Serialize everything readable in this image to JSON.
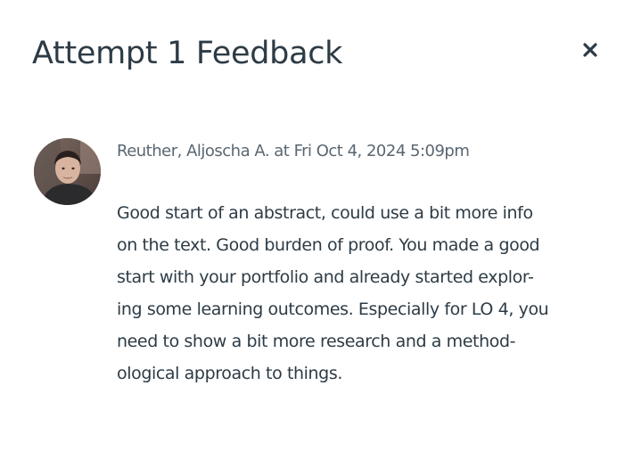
{
  "dialog": {
    "title": "Attempt 1 Feedback",
    "close_icon": "close-icon"
  },
  "comment": {
    "avatar_icon": "user-avatar-photo",
    "meta": "Reuther, Aljoscha A. at Fri Oct 4, 2024 5:09pm",
    "lines": [
      "Good start of an abstract, could use a bit more info",
      "on the text. Good burden of proof. You made a good",
      "start with your portfolio and already started explor-",
      "ing some learning outcomes. Especially for LO 4, you",
      "need to show a bit more research and a method-",
      "ological approach to things."
    ]
  },
  "colors": {
    "text": "#2d3b45",
    "meta_text": "#5a6670",
    "background": "#ffffff"
  }
}
